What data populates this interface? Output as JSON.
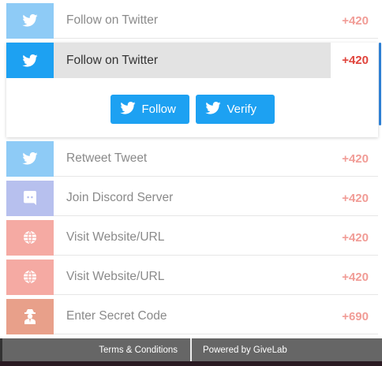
{
  "entries": [
    {
      "label": "Follow on Twitter",
      "points": "+420",
      "icon": "twitter-icon"
    },
    {
      "label": "Follow on Twitter",
      "points": "+420",
      "icon": "twitter-icon"
    },
    {
      "label": "Retweet Tweet",
      "points": "+420",
      "icon": "twitter-icon"
    },
    {
      "label": "Join Discord Server",
      "points": "+420",
      "icon": "discord-icon"
    },
    {
      "label": "Visit Website/URL",
      "points": "+420",
      "icon": "globe-icon"
    },
    {
      "label": "Visit Website/URL",
      "points": "+420",
      "icon": "globe-icon"
    },
    {
      "label": "Enter Secret Code",
      "points": "+690",
      "icon": "secret-agent-icon"
    }
  ],
  "actions": {
    "follow_label": "Follow",
    "verify_label": "Verify"
  },
  "footer": {
    "terms": "Terms & Conditions",
    "powered": "Powered by GiveLab"
  },
  "colors": {
    "twitter": "#1da1f2",
    "twitter_light": "#8ecbf6",
    "discord": "#b7c0ee",
    "web": "#f5aaa3",
    "secret": "#e8a08a",
    "points": "#f19c96",
    "points_active": "#e0443c"
  }
}
